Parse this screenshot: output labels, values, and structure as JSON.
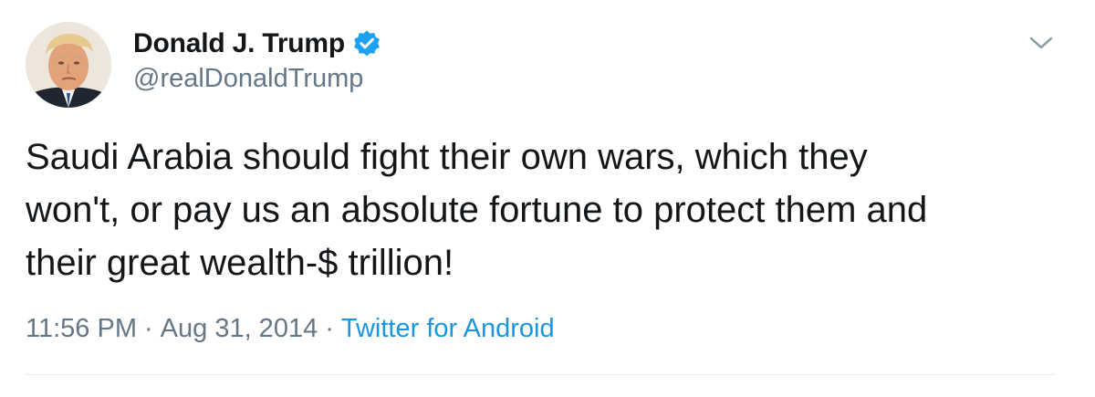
{
  "author": {
    "display_name": "Donald J. Trump",
    "handle": "@realDonaldTrump",
    "verified": true,
    "avatar_icon": "profile-photo"
  },
  "tweet": {
    "lines": [
      "Saudi Arabia should fight their own wars, which they",
      "won't, or pay us an absolute fortune to protect them and",
      "their great wealth-$ trillion!"
    ]
  },
  "meta": {
    "time": "11:56 PM",
    "separator": "·",
    "date": "Aug 31, 2014",
    "source": "Twitter for Android"
  },
  "colors": {
    "text": "#14171a",
    "secondary": "#657786",
    "accent": "#1b95e0",
    "divider": "#e6ecf0"
  },
  "icons": {
    "verified": "verified-badge-icon",
    "more": "chevron-down-icon"
  }
}
